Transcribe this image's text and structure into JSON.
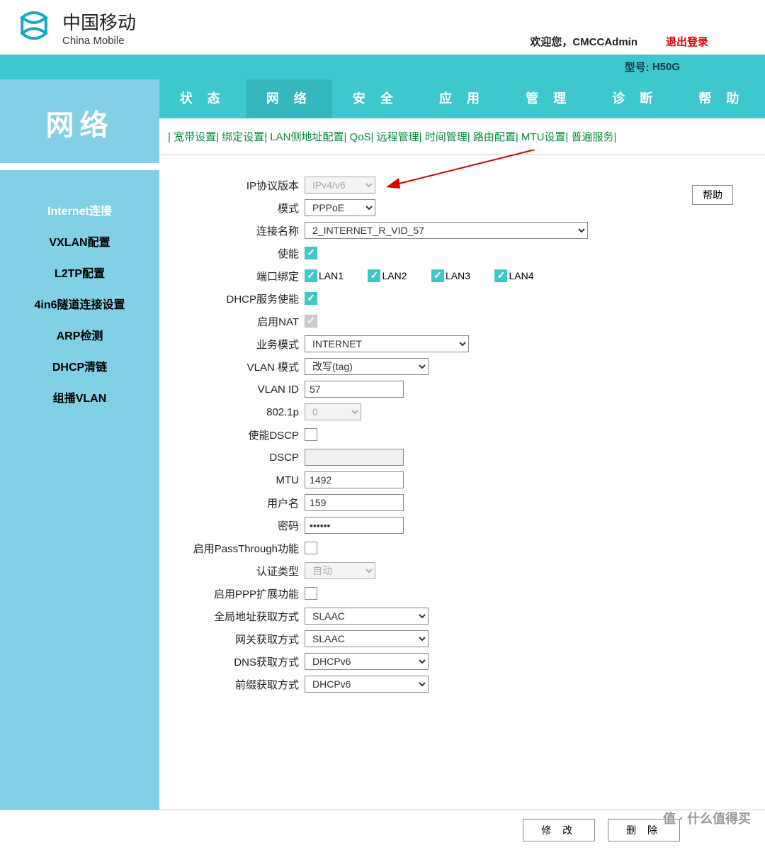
{
  "logo": {
    "cn": "中国移动",
    "en": "China Mobile"
  },
  "header": {
    "welcome": "欢迎您，CMCCAdmin",
    "logout": "退出登录",
    "model_label": "型号:",
    "model": "H50G"
  },
  "topnav": [
    "状 态",
    "网 络",
    "安 全",
    "应 用",
    "管 理",
    "诊 断",
    "帮 助"
  ],
  "subnav": [
    "宽带设置",
    "绑定设置",
    "LAN侧地址配置",
    "QoS",
    "远程管理",
    "时间管理",
    "路由配置",
    "MTU设置",
    "普遍服务"
  ],
  "sidebar": {
    "title": "网络",
    "items": [
      "Internet连接",
      "VXLAN配置",
      "L2TP配置",
      "4in6隧道连接设置",
      "ARP检测",
      "DHCP清链",
      "组播VLAN"
    ]
  },
  "help_btn": "帮助",
  "form": {
    "ip_proto": {
      "label": "IP协议版本",
      "value": "IPv4/v6"
    },
    "mode": {
      "label": "模式",
      "value": "PPPoE"
    },
    "conn_name": {
      "label": "连接名称",
      "value": "2_INTERNET_R_VID_57"
    },
    "enable": {
      "label": "使能"
    },
    "port_bind": {
      "label": "端口绑定",
      "ports": [
        "LAN1",
        "LAN2",
        "LAN3",
        "LAN4"
      ]
    },
    "dhcp_srv": {
      "label": "DHCP服务使能"
    },
    "nat": {
      "label": "启用NAT"
    },
    "biz_mode": {
      "label": "业务模式",
      "value": "INTERNET"
    },
    "vlan_mode": {
      "label": "VLAN 模式",
      "value": "改写(tag)"
    },
    "vlan_id": {
      "label": "VLAN ID",
      "value": "57"
    },
    "dot1p": {
      "label": "802.1p",
      "value": "0"
    },
    "dscp_en": {
      "label": "使能DSCP"
    },
    "dscp": {
      "label": "DSCP",
      "value": ""
    },
    "mtu": {
      "label": "MTU",
      "value": "1492"
    },
    "user": {
      "label": "用户名",
      "value": "159"
    },
    "pass": {
      "label": "密码",
      "value": "••••••"
    },
    "passthrough": {
      "label": "启用PassThrough功能"
    },
    "auth_type": {
      "label": "认证类型",
      "value": "自动"
    },
    "ppp_ext": {
      "label": "启用PPP扩展功能"
    },
    "global_addr": {
      "label": "全局地址获取方式",
      "value": "SLAAC"
    },
    "gw": {
      "label": "网关获取方式",
      "value": "SLAAC"
    },
    "dns": {
      "label": "DNS获取方式",
      "value": "DHCPv6"
    },
    "prefix": {
      "label": "前缀获取方式",
      "value": "DHCPv6"
    }
  },
  "footer": {
    "modify": "修 改",
    "delete": "删 除"
  },
  "watermark": "值 · 什么值得买"
}
